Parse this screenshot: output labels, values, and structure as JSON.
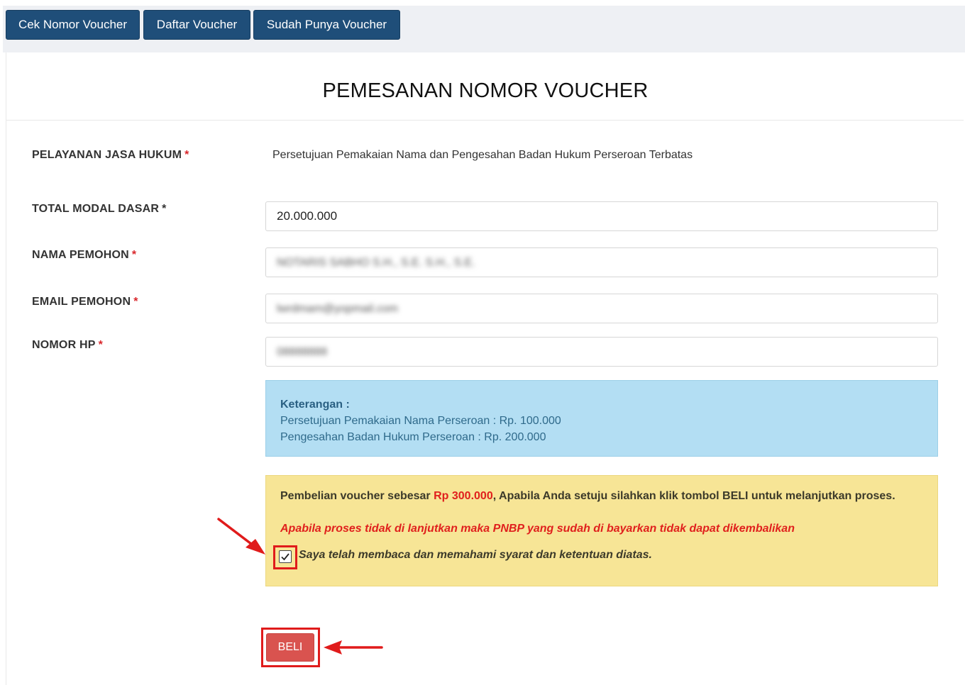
{
  "nav": {
    "items": [
      {
        "label": "Cek Nomor Voucher"
      },
      {
        "label": "Daftar Voucher"
      },
      {
        "label": "Sudah Punya Voucher"
      }
    ]
  },
  "page": {
    "title": "PEMESANAN NOMOR VOUCHER"
  },
  "form": {
    "required_mark": "*",
    "service": {
      "label": "PELAYANAN JASA HUKUM",
      "value": "Persetujuan Pemakaian Nama dan Pengesahan Badan Hukum Perseroan Terbatas"
    },
    "capital": {
      "label": "TOTAL MODAL DASAR",
      "value": "20.000.000"
    },
    "applicant_name": {
      "label": "NAMA PEMOHON",
      "value": "NOTARIS SABHO S.H., S.E. S.H., S.E."
    },
    "applicant_email": {
      "label": "EMAIL PEMOHON",
      "value": "lwrdmam@yopmail.com"
    },
    "phone": {
      "label": "NOMOR HP",
      "value": "08888888"
    }
  },
  "info": {
    "title": "Keterangan :",
    "lines": [
      "Persetujuan Pemakaian Nama Perseroan : Rp. 100.000",
      "Pengesahan Badan Hukum Perseroan : Rp. 200.000"
    ]
  },
  "warning": {
    "prefix": "Pembelian voucher sebesar ",
    "price": "Rp 300.000",
    "suffix": ", Apabila Anda setuju silahkan klik tombol BELI untuk melanjutkan proses.",
    "alert": "Apabila proses tidak di lanjutkan maka PNBP yang sudah di bayarkan tidak dapat dikembalikan",
    "checkbox_label": "Saya telah membaca dan memahami syarat dan ketentuan diatas.",
    "checkbox_checked": true
  },
  "actions": {
    "buy_label": "BELI"
  },
  "colors": {
    "nav_bg": "#1f4e79",
    "info_bg": "#b3def3",
    "warn_bg": "#f7e596",
    "danger": "#e0201d",
    "buy_bg": "#d9534f",
    "annotation": "#e01b1b"
  }
}
